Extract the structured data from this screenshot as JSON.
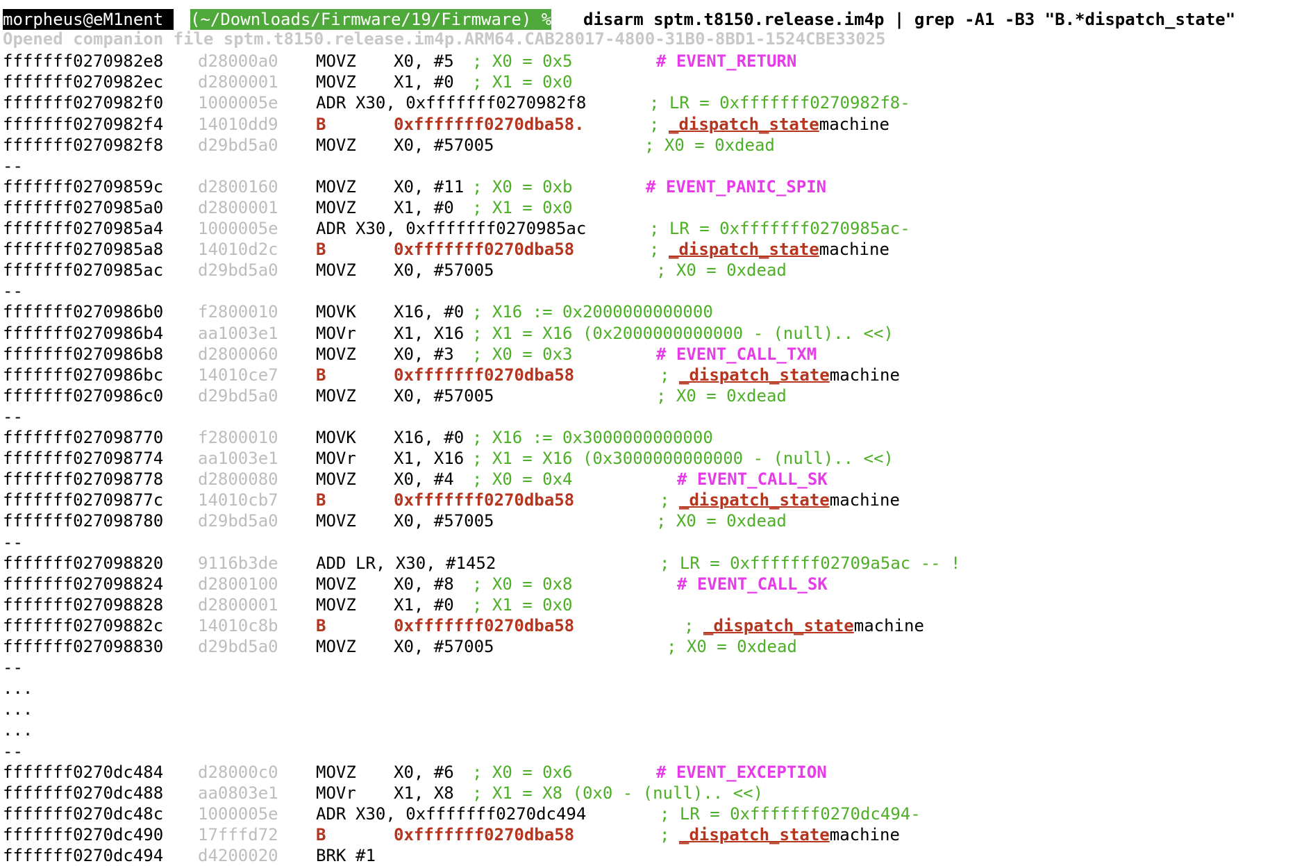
{
  "colors": {
    "address": "#000000",
    "encoding": "#bdbdbd",
    "branch": "#b5351f",
    "comment": "#4caf25",
    "event": "#e53be8",
    "prompt_user_bg": "#000000",
    "prompt_path_bg": "#4fa83a"
  },
  "prompt": {
    "user": "morpheus@eM1nent ",
    "path": "(~/Downloads/Firmware/19/Firmware) %",
    "command": "disarm sptm.t8150.release.im4p | grep -A1 -B3 \"B.*dispatch_state\""
  },
  "opened_line": "Opened companion file sptm.t8150.release.im4p.ARM64.CAB28017-4800-31B0-8BD1-1524CBE33025",
  "separator": "--",
  "ellipsis": "...",
  "machine_suffix": "machine",
  "groups": [
    {
      "rows": [
        {
          "addr": "fffffff0270982e8",
          "enc": "d28000a0",
          "op": "MOVZ",
          "args": "X0, #5",
          "comment": "; X0 = 0x5",
          "event": "# EVENT_RETURN"
        },
        {
          "addr": "fffffff0270982ec",
          "enc": "d2800001",
          "op": "MOVZ",
          "args": "X1, #0",
          "comment": "; X1 = 0x0"
        },
        {
          "addr": "fffffff0270982f0",
          "enc": "1000005e",
          "op": "ADR",
          "args": "X30, 0xfffffff0270982f8",
          "comment": "; LR = 0xfffffff0270982f8-"
        },
        {
          "addr": "fffffff0270982f4",
          "enc": "14010dd9",
          "op": "B",
          "args": "0xfffffff0270dba58.",
          "branch": true,
          "comment": ";",
          "dispatch": "_dispatch_state"
        },
        {
          "addr": "fffffff0270982f8",
          "enc": "d29bd5a0",
          "op": "MOVZ",
          "args": "X0, #57005",
          "comment": "; X0 = 0xdead"
        }
      ]
    },
    {
      "rows": [
        {
          "addr": "fffffff02709859c",
          "enc": "d2800160",
          "op": "MOVZ",
          "args": "X0, #11",
          "comment": "; X0 = 0xb",
          "event": "# EVENT_PANIC_SPIN"
        },
        {
          "addr": "fffffff0270985a0",
          "enc": "d2800001",
          "op": "MOVZ",
          "args": "X1, #0",
          "comment": "; X1 = 0x0"
        },
        {
          "addr": "fffffff0270985a4",
          "enc": "1000005e",
          "op": "ADR",
          "args": "X30, 0xfffffff0270985ac",
          "comment": "; LR = 0xfffffff0270985ac-"
        },
        {
          "addr": "fffffff0270985a8",
          "enc": "14010d2c",
          "op": "B",
          "args": "0xfffffff0270dba58",
          "branch": true,
          "comment": ";",
          "dispatch": "_dispatch_state"
        },
        {
          "addr": "fffffff0270985ac",
          "enc": "d29bd5a0",
          "op": "MOVZ",
          "args": "X0, #57005",
          "comment": "; X0 = 0xdead"
        }
      ]
    },
    {
      "rows": [
        {
          "addr": "fffffff0270986b0",
          "enc": "f2800010",
          "op": "MOVK",
          "args": "X16, #0",
          "comment": "; X16 := 0x2000000000000"
        },
        {
          "addr": "fffffff0270986b4",
          "enc": "aa1003e1",
          "op": "MOVr",
          "args": "X1, X16",
          "comment": "; X1 = X16 (0x2000000000000 - (null).. <<)"
        },
        {
          "addr": "fffffff0270986b8",
          "enc": "d2800060",
          "op": "MOVZ",
          "args": "X0, #3",
          "comment": "; X0 = 0x3",
          "event": "# EVENT_CALL_TXM"
        },
        {
          "addr": "fffffff0270986bc",
          "enc": "14010ce7",
          "op": "B",
          "args": "0xfffffff0270dba58",
          "branch": true,
          "comment": ";",
          "dispatch": "_dispatch_state"
        },
        {
          "addr": "fffffff0270986c0",
          "enc": "d29bd5a0",
          "op": "MOVZ",
          "args": "X0, #57005",
          "comment": "; X0 = 0xdead"
        }
      ]
    },
    {
      "rows": [
        {
          "addr": "fffffff027098770",
          "enc": "f2800010",
          "op": "MOVK",
          "args": "X16, #0",
          "comment": "; X16 := 0x3000000000000"
        },
        {
          "addr": "fffffff027098774",
          "enc": "aa1003e1",
          "op": "MOVr",
          "args": "X1, X16",
          "comment": "; X1 = X16 (0x3000000000000 - (null).. <<)"
        },
        {
          "addr": "fffffff027098778",
          "enc": "d2800080",
          "op": "MOVZ",
          "args": "X0, #4",
          "comment": "; X0 = 0x4",
          "event": "# EVENT_CALL_SK"
        },
        {
          "addr": "fffffff02709877c",
          "enc": "14010cb7",
          "op": "B",
          "args": "0xfffffff0270dba58",
          "branch": true,
          "comment": ";",
          "dispatch": "_dispatch_state"
        },
        {
          "addr": "fffffff027098780",
          "enc": "d29bd5a0",
          "op": "MOVZ",
          "args": "X0, #57005",
          "comment": "; X0 = 0xdead"
        }
      ]
    },
    {
      "rows": [
        {
          "addr": "fffffff027098820",
          "enc": "9116b3de",
          "op": "ADD",
          "args": "LR, X30, #1452",
          "comment": "; LR = 0xfffffff02709a5ac -- !"
        },
        {
          "addr": "fffffff027098824",
          "enc": "d2800100",
          "op": "MOVZ",
          "args": "X0, #8",
          "comment": "; X0 = 0x8",
          "event": "# EVENT_CALL_SK"
        },
        {
          "addr": "fffffff027098828",
          "enc": "d2800001",
          "op": "MOVZ",
          "args": "X1, #0",
          "comment": "; X1 = 0x0"
        },
        {
          "addr": "fffffff02709882c",
          "enc": "14010c8b",
          "op": "B",
          "args": "0xfffffff0270dba58",
          "branch": true,
          "comment": ";",
          "dispatch": "_dispatch_state"
        },
        {
          "addr": "fffffff027098830",
          "enc": "d29bd5a0",
          "op": "MOVZ",
          "args": "X0, #57005",
          "comment": "; X0 = 0xdead"
        }
      ]
    },
    {
      "rows": [
        {
          "addr": "fffffff0270dc484",
          "enc": "d28000c0",
          "op": "MOVZ",
          "args": "X0, #6",
          "comment": "; X0 = 0x6",
          "event": "# EVENT_EXCEPTION"
        },
        {
          "addr": "fffffff0270dc488",
          "enc": "aa0803e1",
          "op": "MOVr",
          "args": "X1, X8",
          "comment": "; X1 = X8 (0x0 - (null).. <<)"
        },
        {
          "addr": "fffffff0270dc48c",
          "enc": "1000005e",
          "op": "ADR",
          "args": "X30, 0xfffffff0270dc494",
          "comment": "; LR = 0xfffffff0270dc494-"
        },
        {
          "addr": "fffffff0270dc490",
          "enc": "17fffd72",
          "op": "B",
          "args": "0xfffffff0270dba58",
          "branch": true,
          "comment": ";",
          "dispatch": "_dispatch_state"
        },
        {
          "addr": "fffffff0270dc494",
          "enc": "d4200020",
          "op": "BRK",
          "args": "#1"
        }
      ]
    }
  ]
}
